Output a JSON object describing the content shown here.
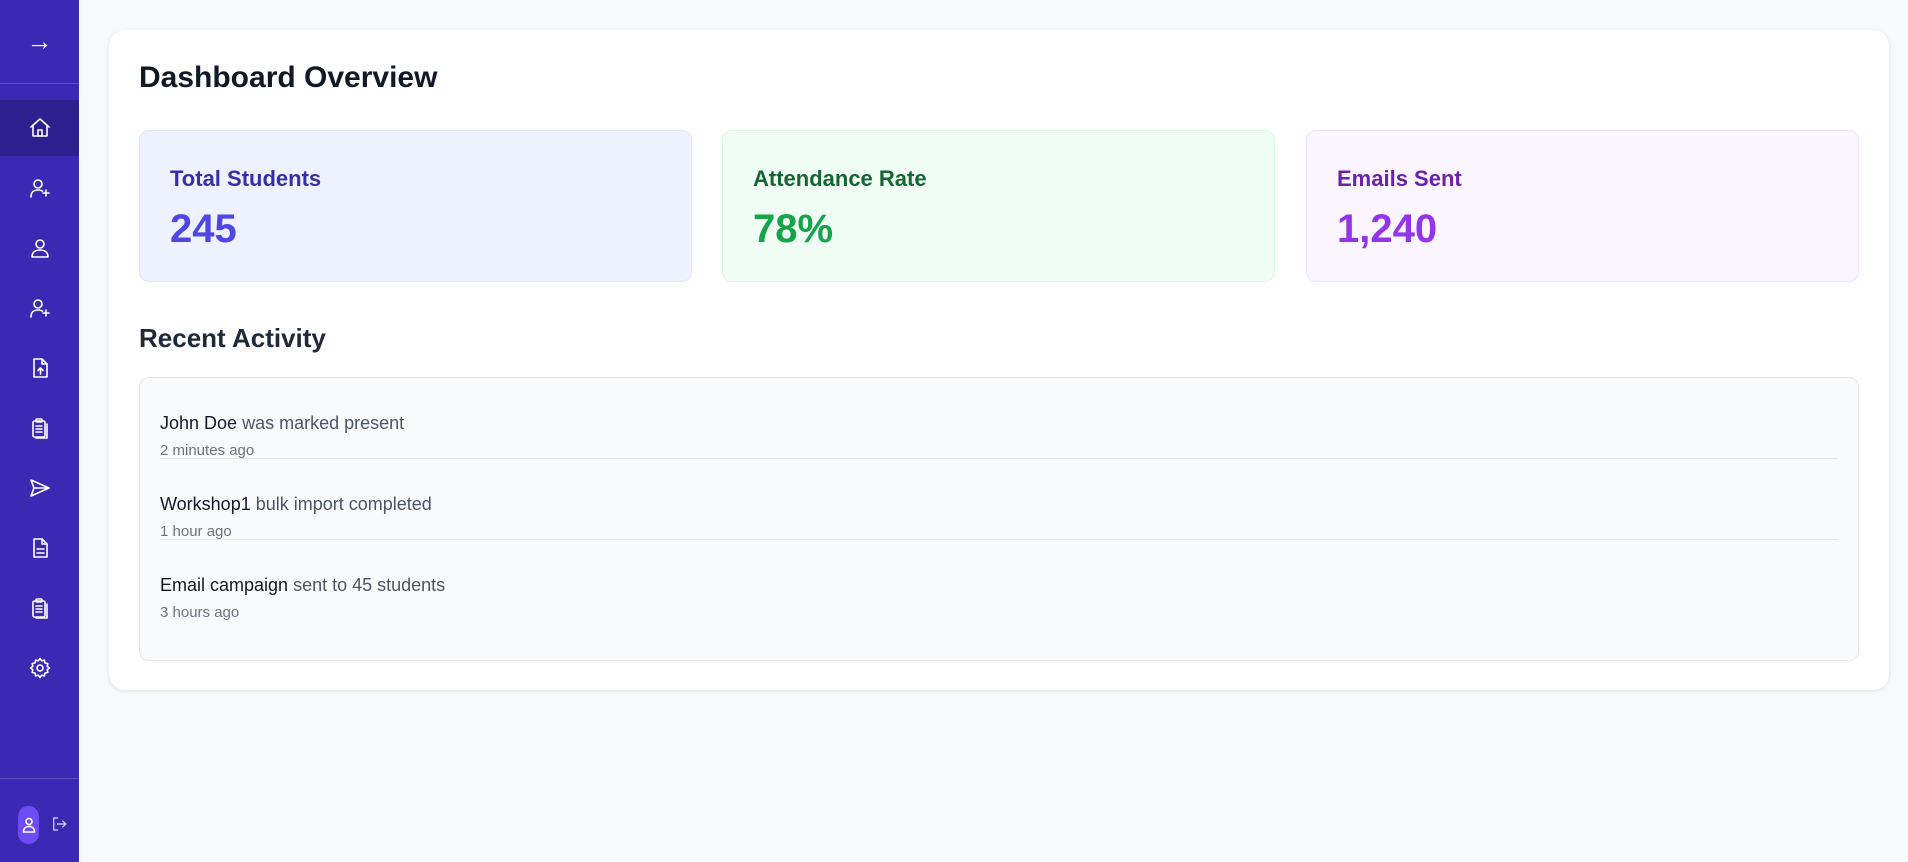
{
  "sidebar": {
    "toggle_icon": "arrow-right-icon",
    "items": [
      {
        "icon": "home-icon",
        "active": true
      },
      {
        "icon": "user-plus-icon",
        "active": false
      },
      {
        "icon": "user-icon",
        "active": false
      },
      {
        "icon": "user-plus-icon",
        "active": false
      },
      {
        "icon": "file-upload-icon",
        "active": false
      },
      {
        "icon": "clipboard-list-icon",
        "active": false
      },
      {
        "icon": "send-icon",
        "active": false
      },
      {
        "icon": "file-text-icon",
        "active": false
      },
      {
        "icon": "clipboard-list-icon",
        "active": false
      },
      {
        "icon": "gear-icon",
        "active": false
      }
    ],
    "footer": {
      "avatar_icon": "user-icon",
      "logout_icon": "logout-icon"
    }
  },
  "main": {
    "title": "Dashboard Overview",
    "stats": [
      {
        "label": "Total Students",
        "value": "245",
        "color": "#4f46e5"
      },
      {
        "label": "Attendance Rate",
        "value": "78%",
        "color": "#16a34a"
      },
      {
        "label": "Emails Sent",
        "value": "1,240",
        "color": "#9333ea"
      }
    ],
    "recent_activity": {
      "title": "Recent Activity",
      "items": [
        {
          "subject": "John Doe",
          "action": " was marked present",
          "time": "2 minutes ago"
        },
        {
          "subject": "Workshop1",
          "action": " bulk import completed",
          "time": "1 hour ago"
        },
        {
          "subject": "Email campaign",
          "action": " sent to 45 students",
          "time": "3 hours ago"
        }
      ]
    }
  },
  "colors": {
    "sidebar_bg": "#3b28b3",
    "sidebar_active": "#2e1f8f",
    "page_bg": "#f8f9fb"
  }
}
